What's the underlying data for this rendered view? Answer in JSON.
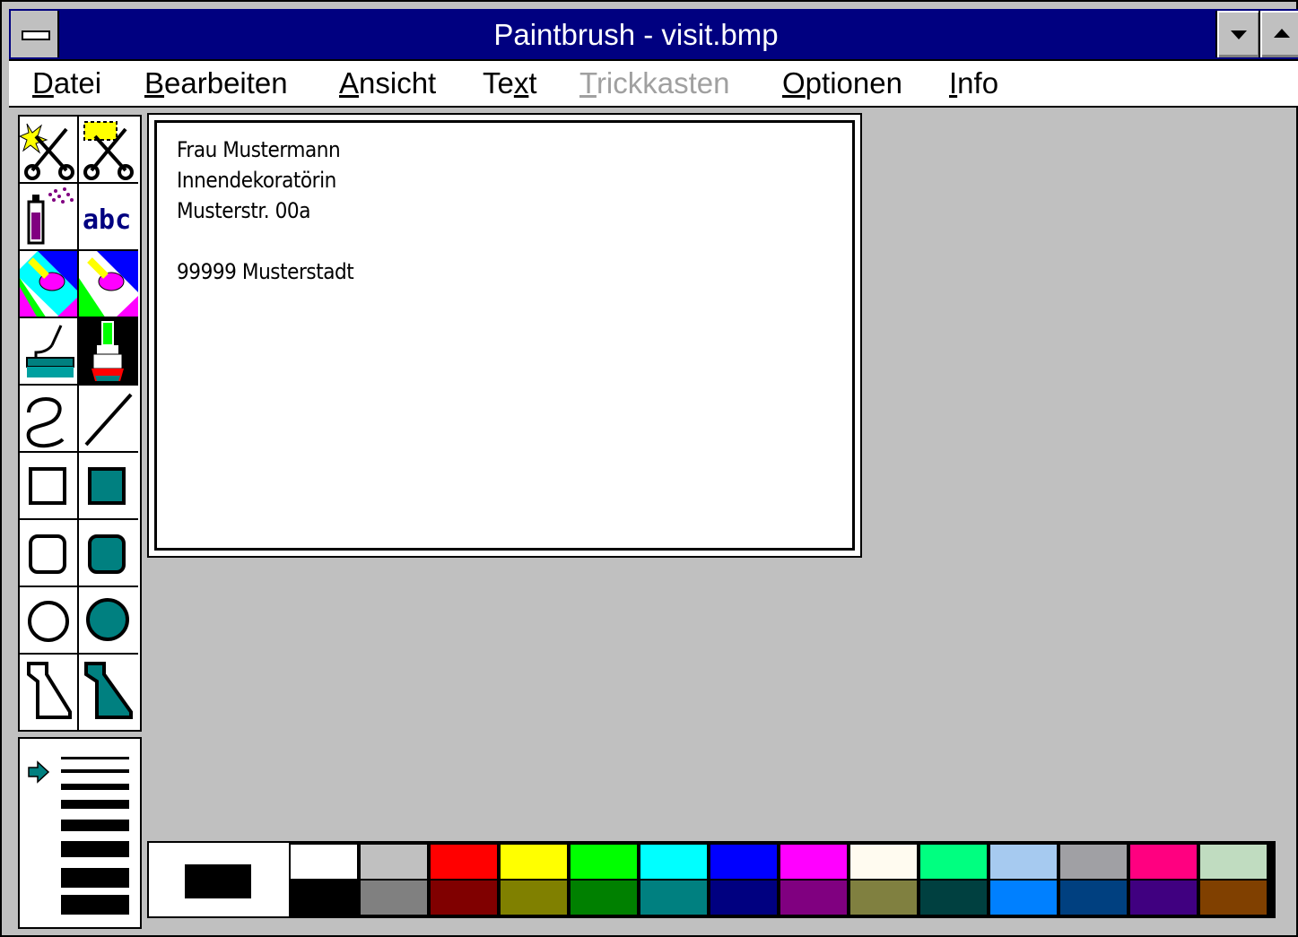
{
  "window": {
    "title": "Paintbrush - visit.bmp"
  },
  "menu": {
    "items": [
      {
        "pre": "",
        "key": "D",
        "post": "atei",
        "enabled": true
      },
      {
        "pre": "",
        "key": "B",
        "post": "earbeiten",
        "enabled": true
      },
      {
        "pre": "",
        "key": "A",
        "post": "nsicht",
        "enabled": true
      },
      {
        "pre": "Te",
        "key": "x",
        "post": "t",
        "enabled": true
      },
      {
        "pre": "",
        "key": "T",
        "post": "rickkasten",
        "enabled": false
      },
      {
        "pre": "",
        "key": "O",
        "post": "ptionen",
        "enabled": true
      },
      {
        "pre": "",
        "key": "I",
        "post": "nfo",
        "enabled": true
      }
    ]
  },
  "tools": [
    {
      "name": "scissors-free-select-icon"
    },
    {
      "name": "scissors-rect-select-icon"
    },
    {
      "name": "spray-can-icon"
    },
    {
      "name": "text-tool-icon",
      "label": "abc"
    },
    {
      "name": "color-eraser-icon"
    },
    {
      "name": "eraser-icon"
    },
    {
      "name": "paint-roller-icon"
    },
    {
      "name": "brush-icon",
      "selected": true
    },
    {
      "name": "curve-icon"
    },
    {
      "name": "line-icon"
    },
    {
      "name": "rectangle-icon"
    },
    {
      "name": "filled-rectangle-icon"
    },
    {
      "name": "rounded-rectangle-icon"
    },
    {
      "name": "filled-rounded-rectangle-icon"
    },
    {
      "name": "ellipse-icon"
    },
    {
      "name": "filled-ellipse-icon"
    },
    {
      "name": "polygon-icon"
    },
    {
      "name": "filled-polygon-icon"
    }
  ],
  "canvas": {
    "lines": [
      "Frau Mustermann",
      "Innendekoratörin",
      "Musterstr. 00a",
      "",
      "99999 Musterstadt"
    ]
  },
  "palette": {
    "foreground": "#000000",
    "background": "#ffffff",
    "top_row": [
      "#ffffff",
      "#c0c0c0",
      "#ff0000",
      "#ffff00",
      "#00ff00",
      "#00ffff",
      "#0000ff",
      "#ff00ff",
      "#fffbf0",
      "#00ff80",
      "#a6caf0",
      "#a0a0a4",
      "#ff0080",
      "#c0dcc0"
    ],
    "bottom_row": [
      "#000000",
      "#808080",
      "#800000",
      "#808000",
      "#008000",
      "#008080",
      "#000080",
      "#800080",
      "#808040",
      "#004040",
      "#0080ff",
      "#004080",
      "#400080",
      "#804000"
    ]
  },
  "colors": {
    "titlebar": "#000080",
    "accent_teal": "#008080"
  }
}
